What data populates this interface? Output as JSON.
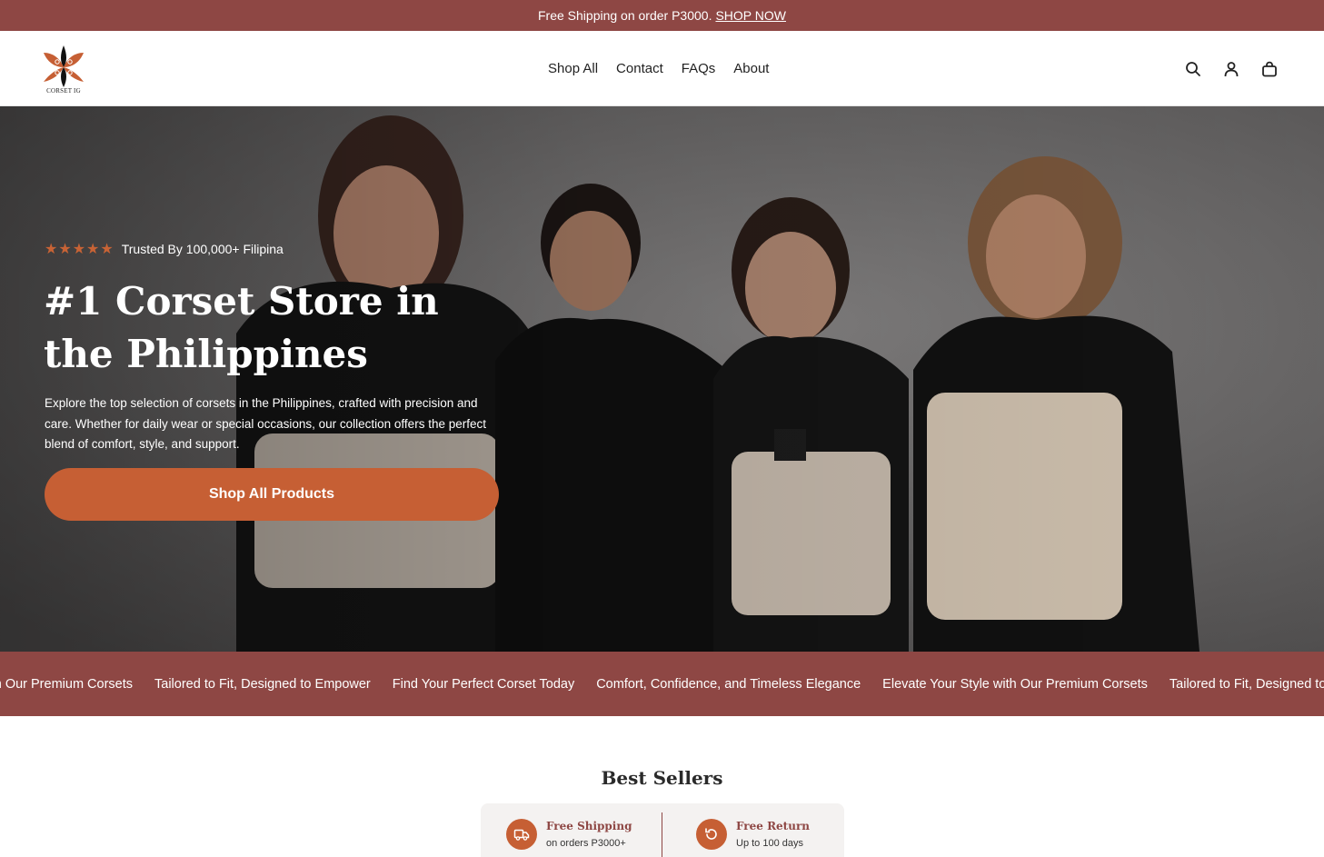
{
  "announcement": {
    "text": "Free Shipping on order P3000.",
    "link": "SHOP NOW"
  },
  "header": {
    "logo_text": "CORSET IG",
    "nav": [
      "Shop All",
      "Contact",
      "FAQs",
      "About"
    ],
    "icons": [
      "search-icon",
      "account-icon",
      "cart-icon"
    ]
  },
  "hero": {
    "stars": "★★★★★",
    "rating_text": "Trusted By 100,000+ Filipina",
    "title": "#1 Corset Store in the Philippines",
    "description": "Explore the top selection of corsets in the Philippines, crafted with precision and care. Whether for daily wear or special occasions, our collection offers the perfect blend of comfort, style, and support.",
    "cta": "Shop All Products"
  },
  "marquee": [
    "with Our Premium Corsets",
    "Tailored to Fit, Designed to Empower",
    "Find Your Perfect Corset Today",
    "Comfort, Confidence, and Timeless Elegance",
    "Elevate Your Style with Our Premium Corsets",
    "Tailored to Fit, Designed to Empo"
  ],
  "best_sellers": {
    "title": "Best Sellers",
    "perks": [
      {
        "title": "Free Shipping",
        "subtitle": "on orders P3000+",
        "icon": "truck-icon"
      },
      {
        "title": "Free Return",
        "subtitle": "Up to 100 days",
        "icon": "return-icon"
      }
    ]
  },
  "colors": {
    "brand": "#8e4744",
    "accent": "#c65f34"
  }
}
